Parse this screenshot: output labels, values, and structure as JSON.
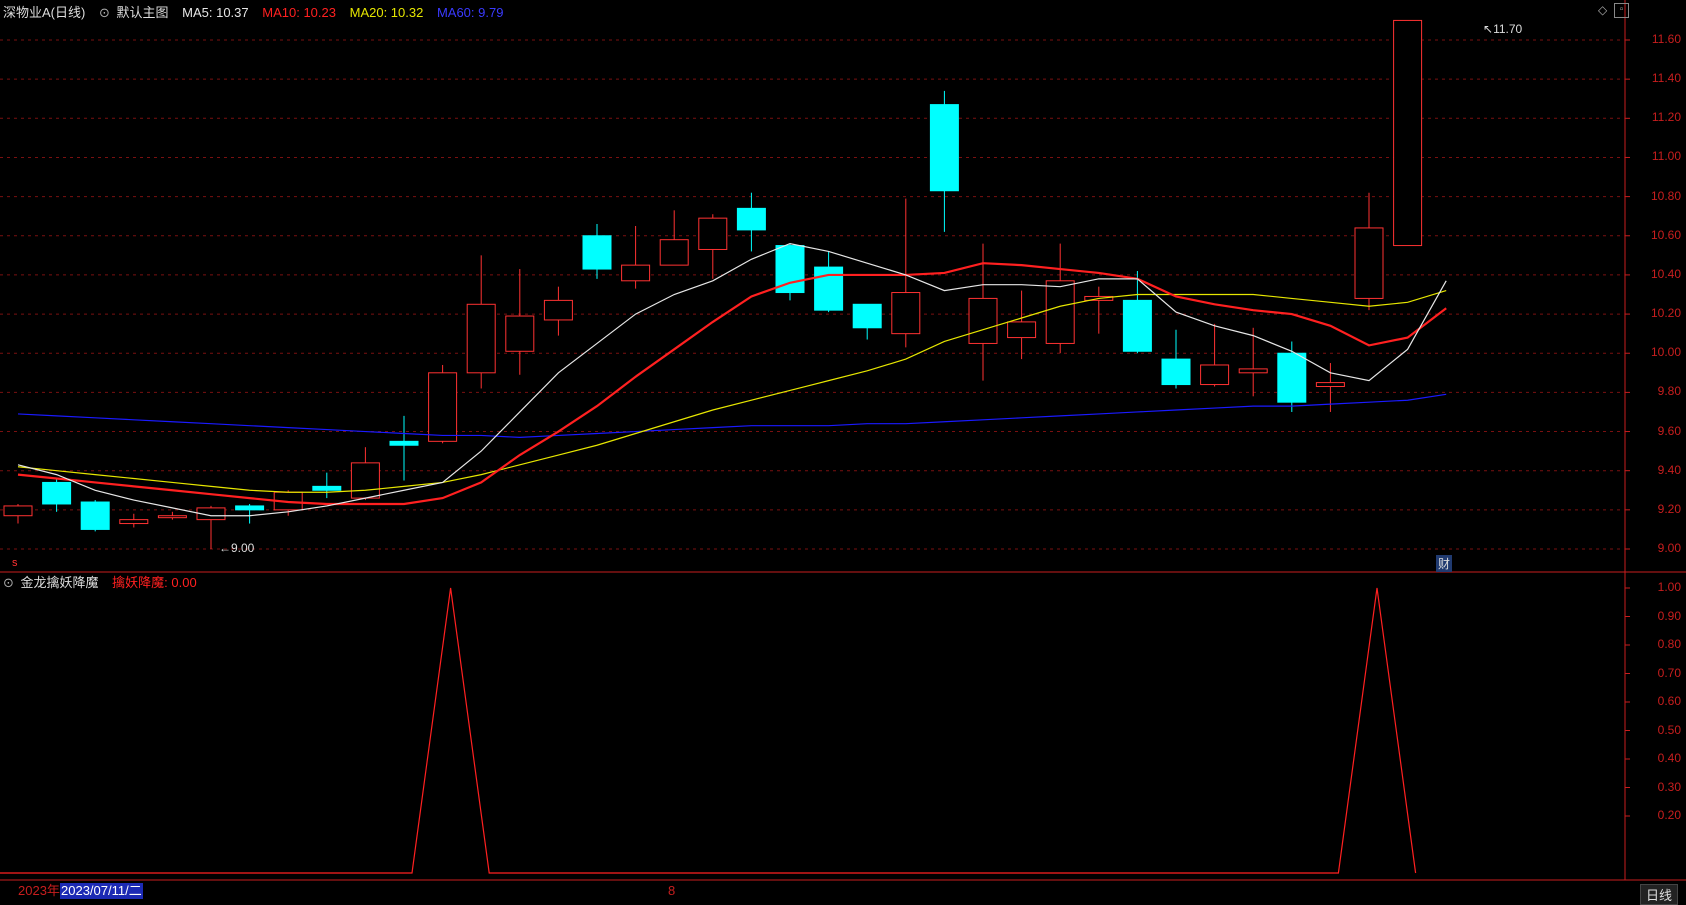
{
  "header": {
    "stock_name": "深物业A(日线)",
    "template": "默认主图",
    "ma5": "MA5: 10.37",
    "ma10": "MA10: 10.23",
    "ma20": "MA20: 10.32",
    "ma60": "MA60: 9.79"
  },
  "sub_header": {
    "indicator": "金龙擒妖降魔",
    "value": "擒妖降魔: 0.00"
  },
  "markers": {
    "max_label": "11.70",
    "min_label": "9.00",
    "left_tag": "s",
    "report_tag": "财"
  },
  "bottom": {
    "year": "2023年",
    "date": "2023/07/11/二",
    "month_mark": "8",
    "period_button": "日线"
  },
  "colors": {
    "up": "#ff3232",
    "down": "#00ffff",
    "ma5": "#e6e6e6",
    "ma10": "#ff2020",
    "ma20": "#e6e600",
    "ma60": "#1a1aff",
    "grid": "#7a1010",
    "axis": "#c81e1e"
  },
  "chart_data": [
    {
      "type": "candlestick",
      "title": "深物业A(日线)",
      "y_ticks": [
        "9.00",
        "9.20",
        "9.40",
        "9.60",
        "9.80",
        "10.00",
        "10.20",
        "10.40",
        "10.60",
        "10.80",
        "11.00",
        "11.20",
        "11.40",
        "11.60"
      ],
      "ylim": [
        8.92,
        11.79
      ],
      "candles": [
        {
          "o": 9.17,
          "c": 9.22,
          "h": 9.23,
          "l": 9.13
        },
        {
          "o": 9.34,
          "c": 9.23,
          "h": 9.36,
          "l": 9.19
        },
        {
          "o": 9.24,
          "c": 9.1,
          "h": 9.25,
          "l": 9.09
        },
        {
          "o": 9.13,
          "c": 9.15,
          "h": 9.18,
          "l": 9.11
        },
        {
          "o": 9.16,
          "c": 9.17,
          "h": 9.19,
          "l": 9.15
        },
        {
          "o": 9.15,
          "c": 9.21,
          "h": 9.22,
          "l": 9.0
        },
        {
          "o": 9.22,
          "c": 9.2,
          "h": 9.23,
          "l": 9.13
        },
        {
          "o": 9.2,
          "c": 9.29,
          "h": 9.3,
          "l": 9.17
        },
        {
          "o": 9.32,
          "c": 9.3,
          "h": 9.39,
          "l": 9.26
        },
        {
          "o": 9.26,
          "c": 9.44,
          "h": 9.52,
          "l": 9.25
        },
        {
          "o": 9.55,
          "c": 9.53,
          "h": 9.68,
          "l": 9.35
        },
        {
          "o": 9.55,
          "c": 9.9,
          "h": 9.94,
          "l": 9.54
        },
        {
          "o": 9.9,
          "c": 10.25,
          "h": 10.5,
          "l": 9.82
        },
        {
          "o": 10.01,
          "c": 10.19,
          "h": 10.43,
          "l": 9.89
        },
        {
          "o": 10.17,
          "c": 10.27,
          "h": 10.34,
          "l": 10.09
        },
        {
          "o": 10.6,
          "c": 10.43,
          "h": 10.66,
          "l": 10.38
        },
        {
          "o": 10.37,
          "c": 10.45,
          "h": 10.65,
          "l": 10.33
        },
        {
          "o": 10.45,
          "c": 10.58,
          "h": 10.73,
          "l": 10.45
        },
        {
          "o": 10.53,
          "c": 10.69,
          "h": 10.71,
          "l": 10.38
        },
        {
          "o": 10.74,
          "c": 10.63,
          "h": 10.82,
          "l": 10.52
        },
        {
          "o": 10.55,
          "c": 10.31,
          "h": 10.56,
          "l": 10.27
        },
        {
          "o": 10.44,
          "c": 10.22,
          "h": 10.52,
          "l": 10.21
        },
        {
          "o": 10.25,
          "c": 10.13,
          "h": 10.25,
          "l": 10.07
        },
        {
          "o": 10.1,
          "c": 10.31,
          "h": 10.79,
          "l": 10.03
        },
        {
          "o": 11.27,
          "c": 10.83,
          "h": 11.34,
          "l": 10.62
        },
        {
          "o": 10.05,
          "c": 10.28,
          "h": 10.56,
          "l": 9.86
        },
        {
          "o": 10.08,
          "c": 10.16,
          "h": 10.32,
          "l": 9.97
        },
        {
          "o": 10.05,
          "c": 10.37,
          "h": 10.56,
          "l": 10.0
        },
        {
          "o": 10.27,
          "c": 10.29,
          "h": 10.34,
          "l": 10.1
        },
        {
          "o": 10.27,
          "c": 10.01,
          "h": 10.42,
          "l": 10.0
        },
        {
          "o": 9.97,
          "c": 9.84,
          "h": 10.12,
          "l": 9.82
        },
        {
          "o": 9.84,
          "c": 9.94,
          "h": 10.15,
          "l": 9.83
        },
        {
          "o": 9.9,
          "c": 9.92,
          "h": 10.13,
          "l": 9.78
        },
        {
          "o": 10.0,
          "c": 9.75,
          "h": 10.06,
          "l": 9.7
        },
        {
          "o": 9.83,
          "c": 9.85,
          "h": 9.95,
          "l": 9.7
        },
        {
          "o": 10.28,
          "c": 10.64,
          "h": 10.82,
          "l": 10.22
        },
        {
          "o": 10.55,
          "c": 11.7,
          "h": 11.7,
          "l": 10.55
        }
      ],
      "ma5": [
        9.43,
        9.38,
        9.3,
        9.25,
        9.21,
        9.17,
        9.17,
        9.19,
        9.22,
        9.26,
        9.3,
        9.34,
        9.5,
        9.7,
        9.9,
        10.05,
        10.2,
        10.3,
        10.37,
        10.48,
        10.56,
        10.52,
        10.46,
        10.4,
        10.32,
        10.35,
        10.35,
        10.34,
        10.38,
        10.38,
        10.21,
        10.14,
        10.09,
        10.01,
        9.9,
        9.86,
        10.02,
        10.37
      ],
      "ma10": [
        9.38,
        9.36,
        9.34,
        9.32,
        9.3,
        9.28,
        9.26,
        9.24,
        9.23,
        9.23,
        9.23,
        9.26,
        9.34,
        9.48,
        9.6,
        9.73,
        9.88,
        10.02,
        10.16,
        10.29,
        10.36,
        10.4,
        10.4,
        10.4,
        10.41,
        10.46,
        10.45,
        10.43,
        10.41,
        10.38,
        10.29,
        10.25,
        10.22,
        10.2,
        10.14,
        10.04,
        10.08,
        10.23
      ],
      "ma20": [
        9.42,
        9.4,
        9.38,
        9.36,
        9.34,
        9.32,
        9.3,
        9.29,
        9.29,
        9.3,
        9.32,
        9.34,
        9.38,
        9.43,
        9.48,
        9.53,
        9.59,
        9.65,
        9.71,
        9.76,
        9.81,
        9.86,
        9.91,
        9.97,
        10.06,
        10.12,
        10.18,
        10.24,
        10.28,
        10.3,
        10.3,
        10.3,
        10.3,
        10.28,
        10.26,
        10.24,
        10.26,
        10.32
      ],
      "ma60": [
        9.69,
        9.68,
        9.67,
        9.66,
        9.65,
        9.64,
        9.63,
        9.62,
        9.61,
        9.6,
        9.59,
        9.58,
        9.58,
        9.57,
        9.58,
        9.59,
        9.6,
        9.61,
        9.62,
        9.63,
        9.63,
        9.63,
        9.64,
        9.64,
        9.65,
        9.66,
        9.67,
        9.68,
        9.69,
        9.7,
        9.71,
        9.72,
        9.73,
        9.73,
        9.74,
        9.75,
        9.76,
        9.79
      ]
    },
    {
      "type": "line",
      "title": "金龙擒妖降魔",
      "y_ticks": [
        "0.20",
        "0.30",
        "0.40",
        "0.50",
        "0.60",
        "0.70",
        "0.80",
        "0.90",
        "1.00"
      ],
      "ylim": [
        0,
        1.0
      ],
      "series": [
        {
          "name": "擒妖降魔",
          "values": [
            0,
            0,
            0,
            0,
            0,
            0,
            0,
            0,
            0,
            0,
            0,
            1,
            0,
            0,
            0,
            0,
            0,
            0,
            0,
            0,
            0,
            0,
            0,
            0,
            0,
            0,
            0,
            0,
            0,
            0,
            0,
            0,
            0,
            0,
            0,
            1,
            0
          ]
        }
      ]
    }
  ]
}
